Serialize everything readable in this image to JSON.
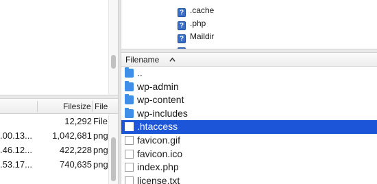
{
  "left_pane": {
    "columns": {
      "filesize": "Filesize",
      "filetype": "File"
    },
    "rows": [
      {
        "date": "",
        "size": "12,292",
        "type": "File"
      },
      {
        "date": ".00.13...",
        "size": "1,042,681",
        "type": "png"
      },
      {
        "date": ".46.12...",
        "size": "422,228",
        "type": "png"
      },
      {
        "date": ".53.17...",
        "size": "740,635",
        "type": "png"
      }
    ]
  },
  "remote_tree": {
    "items": [
      {
        "icon": "question-mark-icon",
        "label": ".cache"
      },
      {
        "icon": "question-mark-icon",
        "label": ".php"
      },
      {
        "icon": "question-mark-icon",
        "label": "Maildir"
      }
    ]
  },
  "remote_list": {
    "header": "Filename",
    "sort": "ascending",
    "selected_color": "#1c55d8",
    "rows": [
      {
        "icon": "folder-icon",
        "name": "..",
        "selected": false
      },
      {
        "icon": "folder-icon",
        "name": "wp-admin",
        "selected": false
      },
      {
        "icon": "folder-icon",
        "name": "wp-content",
        "selected": false
      },
      {
        "icon": "folder-icon",
        "name": "wp-includes",
        "selected": false
      },
      {
        "icon": "file-icon",
        "name": ".htaccess",
        "selected": true
      },
      {
        "icon": "file-icon",
        "name": "favicon.gif",
        "selected": false
      },
      {
        "icon": "file-icon",
        "name": "favicon.ico",
        "selected": false
      },
      {
        "icon": "file-icon",
        "name": "index.php",
        "selected": false
      },
      {
        "icon": "file-icon",
        "name": "license.txt",
        "selected": false
      }
    ]
  }
}
